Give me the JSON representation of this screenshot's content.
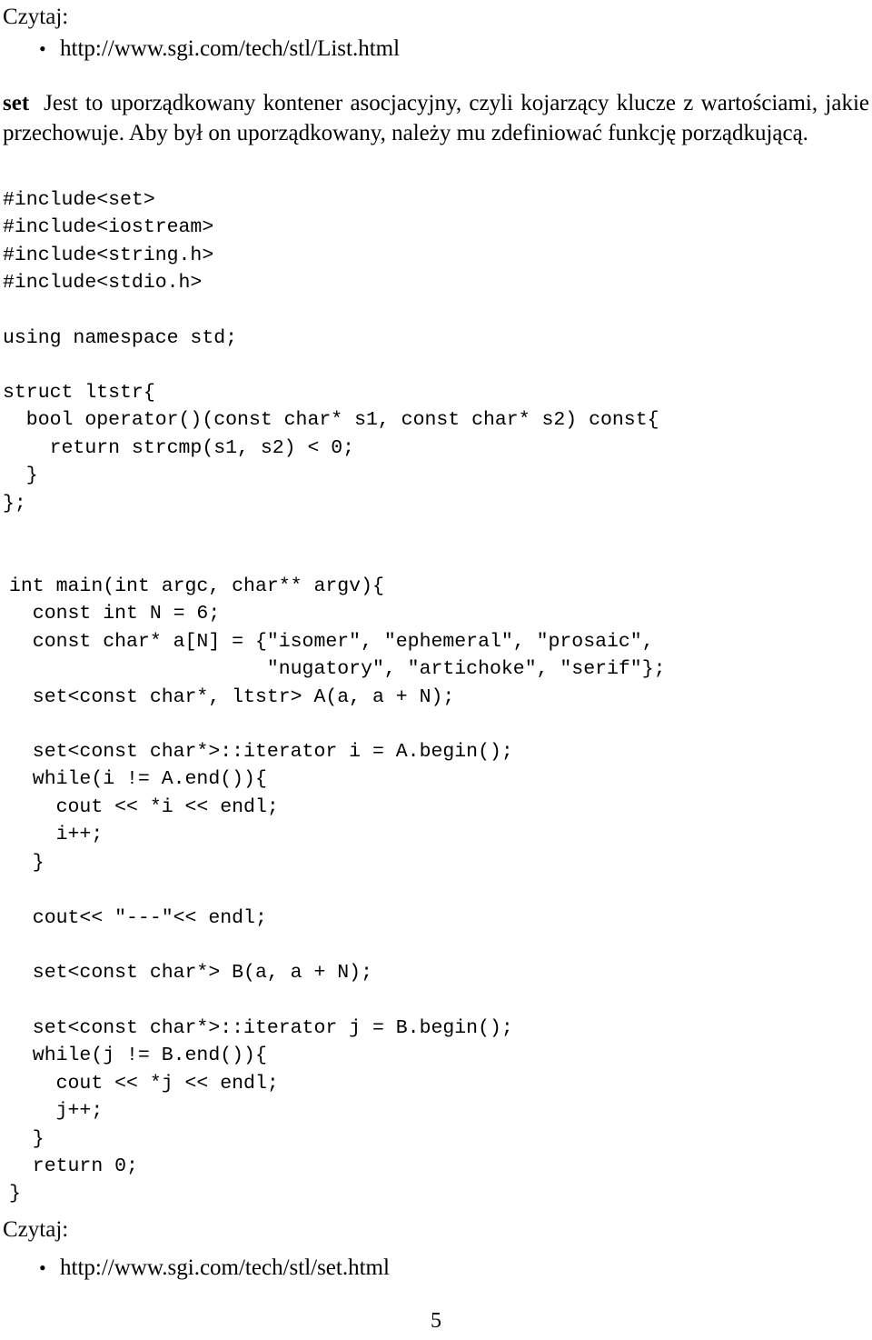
{
  "document": {
    "page_number": "5",
    "language": "pl"
  },
  "sections": {
    "top_read_label": "Czytaj:",
    "top_link": "http://www.sgi.com/tech/stl/List.html",
    "term": "set",
    "term_description": "Jest to uporządkowany kontener asocjacyjny, czyli kojarzący klucze z wartościami, jakie przechowuje. Aby był on uporządkowany, należy mu zdefiniować funkcję porządkującą.",
    "bottom_read_label": "Czytaj:",
    "bottom_link": "http://www.sgi.com/tech/stl/set.html"
  },
  "code_blocks": {
    "includes": "#include<set>\n#include<iostream>\n#include<string.h>\n#include<stdio.h>",
    "using_namespace": "using namespace std;",
    "struct_ltstr": "struct ltstr{\n  bool operator()(const char* s1, const char* s2) const{\n    return strcmp(s1, s2) < 0;\n  }\n};",
    "main_head": "int main(int argc, char** argv){\n  const int N = 6;\n  const char* a[N] = {\"isomer\", \"ephemeral\", \"prosaic\",\n                      \"nugatory\", \"artichoke\", \"serif\"};\n  set<const char*, ltstr> A(a, a + N);",
    "iterate_a": "  set<const char*>::iterator i = A.begin();\n  while(i != A.end()){\n    cout << *i << endl;\n    i++;\n  }",
    "separator_print": "  cout<< \"---\"<< endl;",
    "declare_b": "  set<const char*> B(a, a + N);",
    "iterate_b": "  set<const char*>::iterator j = B.begin();\n  while(j != B.end()){\n    cout << *j << endl;\n    j++;\n  }\n  return 0;\n}"
  },
  "icons": {
    "bullet": "•"
  }
}
